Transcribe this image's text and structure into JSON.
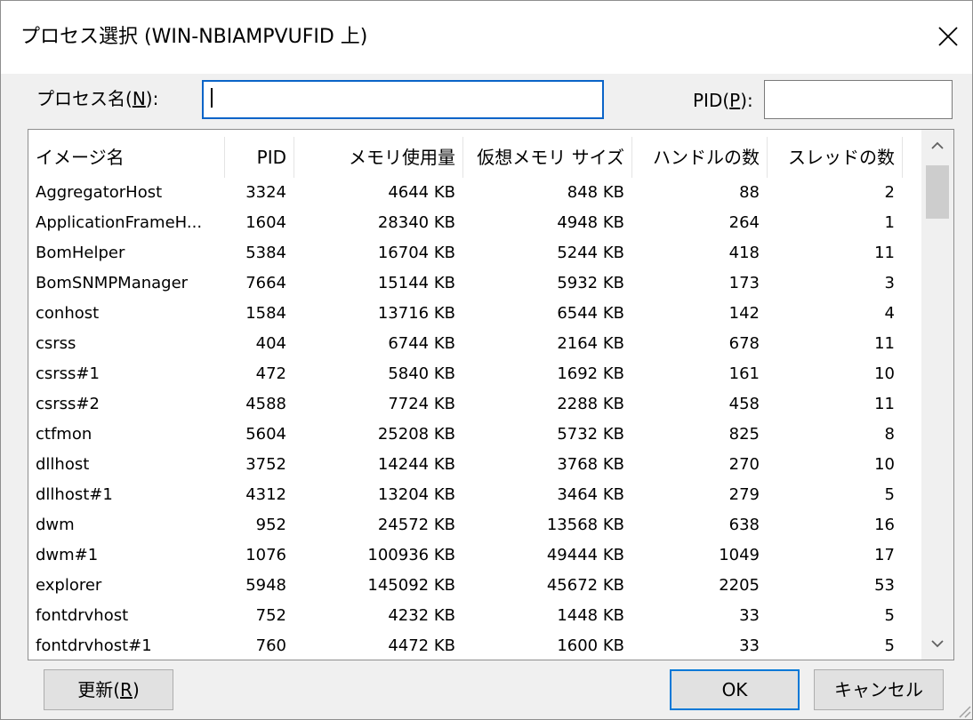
{
  "dialog": {
    "title": "プロセス選択 (WIN-NBIAMPVUFID 上)",
    "close_icon": "close-icon"
  },
  "filters": {
    "name_label_prefix": "プロセス名(",
    "name_label_key": "N",
    "name_label_suffix": "):",
    "name_value": "",
    "pid_label_prefix": "PID(",
    "pid_label_key": "P",
    "pid_label_suffix": "):",
    "pid_value": ""
  },
  "table": {
    "columns": [
      "イメージ名",
      "PID",
      "メモリ使用量",
      "仮想メモリ サイズ",
      "ハンドルの数",
      "スレッドの数"
    ],
    "rows": [
      [
        "AggregatorHost",
        "3324",
        "4644 KB",
        "848 KB",
        "88",
        "2"
      ],
      [
        "ApplicationFrameH...",
        "1604",
        "28340 KB",
        "4948 KB",
        "264",
        "1"
      ],
      [
        "BomHelper",
        "5384",
        "16704 KB",
        "5244 KB",
        "418",
        "11"
      ],
      [
        "BomSNMPManager",
        "7664",
        "15144 KB",
        "5932 KB",
        "173",
        "3"
      ],
      [
        "conhost",
        "1584",
        "13716 KB",
        "6544 KB",
        "142",
        "4"
      ],
      [
        "csrss",
        "404",
        "6744 KB",
        "2164 KB",
        "678",
        "11"
      ],
      [
        "csrss#1",
        "472",
        "5840 KB",
        "1692 KB",
        "161",
        "10"
      ],
      [
        "csrss#2",
        "4588",
        "7724 KB",
        "2288 KB",
        "458",
        "11"
      ],
      [
        "ctfmon",
        "5604",
        "25208 KB",
        "5732 KB",
        "825",
        "8"
      ],
      [
        "dllhost",
        "3752",
        "14244 KB",
        "3768 KB",
        "270",
        "10"
      ],
      [
        "dllhost#1",
        "4312",
        "13204 KB",
        "3464 KB",
        "279",
        "5"
      ],
      [
        "dwm",
        "952",
        "24572 KB",
        "13568 KB",
        "638",
        "16"
      ],
      [
        "dwm#1",
        "1076",
        "100936 KB",
        "49444 KB",
        "1049",
        "17"
      ],
      [
        "explorer",
        "5948",
        "145092 KB",
        "45672 KB",
        "2205",
        "53"
      ],
      [
        "fontdrvhost",
        "752",
        "4232 KB",
        "1448 KB",
        "33",
        "5"
      ],
      [
        "fontdrvhost#1",
        "760",
        "4472 KB",
        "1600 KB",
        "33",
        "5"
      ]
    ]
  },
  "buttons": {
    "refresh_prefix": "更新(",
    "refresh_key": "R",
    "refresh_suffix": ")",
    "ok": "OK",
    "cancel": "キャンセル"
  }
}
